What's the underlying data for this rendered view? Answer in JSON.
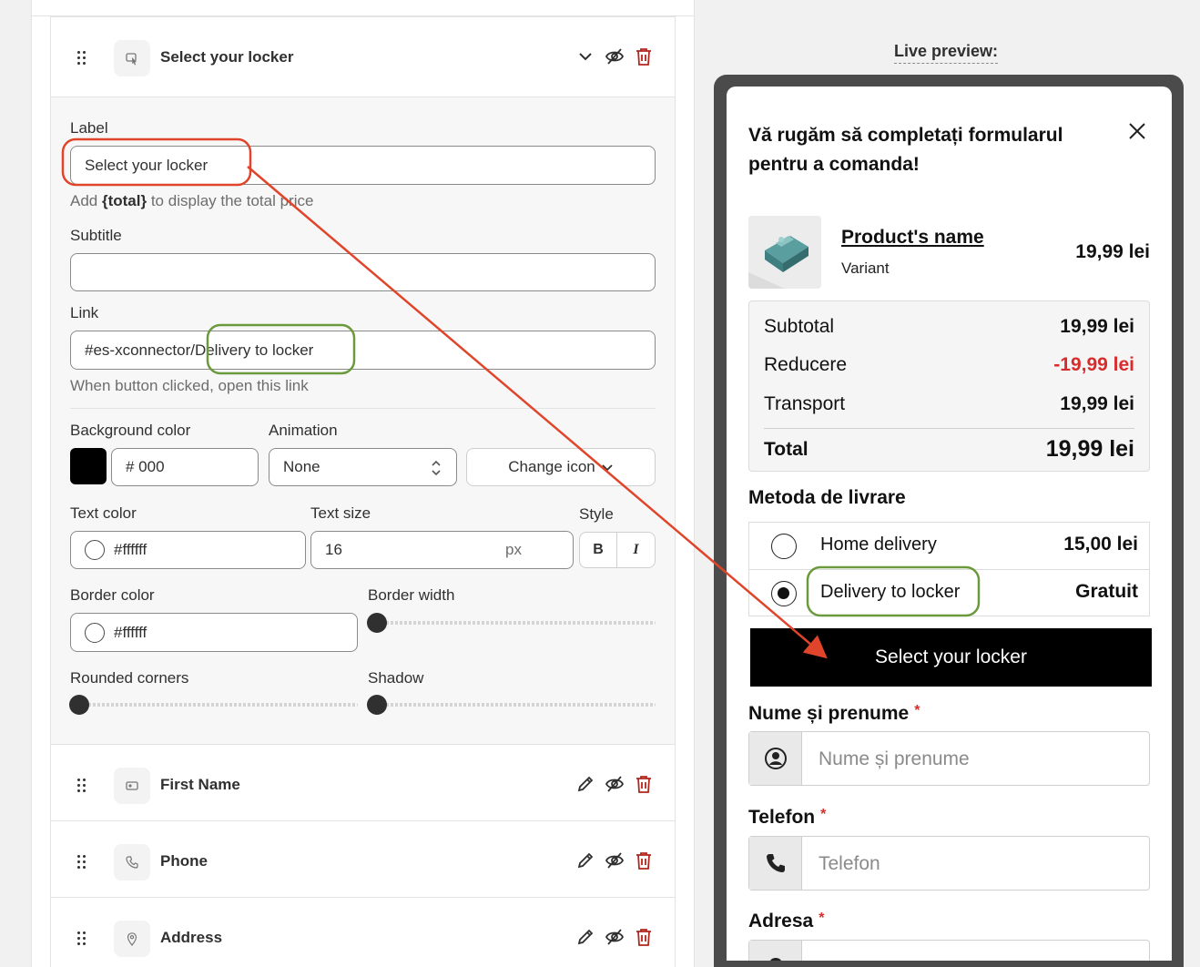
{
  "editor": {
    "active_field": {
      "title": "Select your locker",
      "label_heading": "Label",
      "label_value": "Select your locker",
      "label_help_pre": "Add ",
      "label_help_token": "{total}",
      "label_help_post": " to display the total price",
      "subtitle_heading": "Subtitle",
      "subtitle_value": "",
      "link_heading": "Link",
      "link_value": "#es-xconnector/Delivery to locker",
      "link_help": "When button clicked, open this link",
      "bg_color_heading": "Background color",
      "bg_color_value": "# 000",
      "bg_color_hex": "#000000",
      "animation_heading": "Animation",
      "animation_value": "None",
      "change_icon_label": "Change icon",
      "text_color_heading": "Text color",
      "text_color_value": "#ffffff",
      "text_size_heading": "Text size",
      "text_size_value": "16",
      "text_size_unit": "px",
      "style_heading": "Style",
      "bold_label": "B",
      "italic_label": "I",
      "border_color_heading": "Border color",
      "border_color_value": "#ffffff",
      "border_width_heading": "Border width",
      "border_width_level": 0,
      "rounded_heading": "Rounded corners",
      "rounded_level": 0,
      "shadow_heading": "Shadow",
      "shadow_level": 0
    },
    "other_fields": [
      {
        "title": "First Name",
        "icon": "user-icon"
      },
      {
        "title": "Phone",
        "icon": "phone-icon"
      },
      {
        "title": "Address",
        "icon": "location-pin-icon"
      }
    ]
  },
  "preview": {
    "label": "Live preview:",
    "title": "Vă rugăm să completați formularul pentru a comanda!",
    "product": {
      "name": "Product's name",
      "variant": "Variant",
      "price": "19,99 lei"
    },
    "summary": {
      "subtotal_label": "Subtotal",
      "subtotal_value": "19,99 lei",
      "discount_label": "Reducere",
      "discount_value": "-19,99 lei",
      "shipping_label": "Transport",
      "shipping_value": "19,99 lei",
      "total_label": "Total",
      "total_value": "19,99 lei"
    },
    "shipping_title": "Metoda de livrare",
    "shipping_options": [
      {
        "name": "Home delivery",
        "price": "15,00 lei",
        "selected": false
      },
      {
        "name": "Delivery to locker",
        "price": "Gratuit",
        "selected": true
      }
    ],
    "locker_button": "Select your locker",
    "fields": {
      "name_label": "Nume și prenume",
      "name_placeholder": "Nume și prenume",
      "phone_label": "Telefon",
      "phone_placeholder": "Telefon",
      "address_label": "Adresa",
      "required_mark": "*"
    }
  },
  "colors": {
    "accent_red": "#d72c2c",
    "annotation_red": "#e0452b",
    "annotation_green": "#6a9a3c",
    "primary": "#000000"
  }
}
